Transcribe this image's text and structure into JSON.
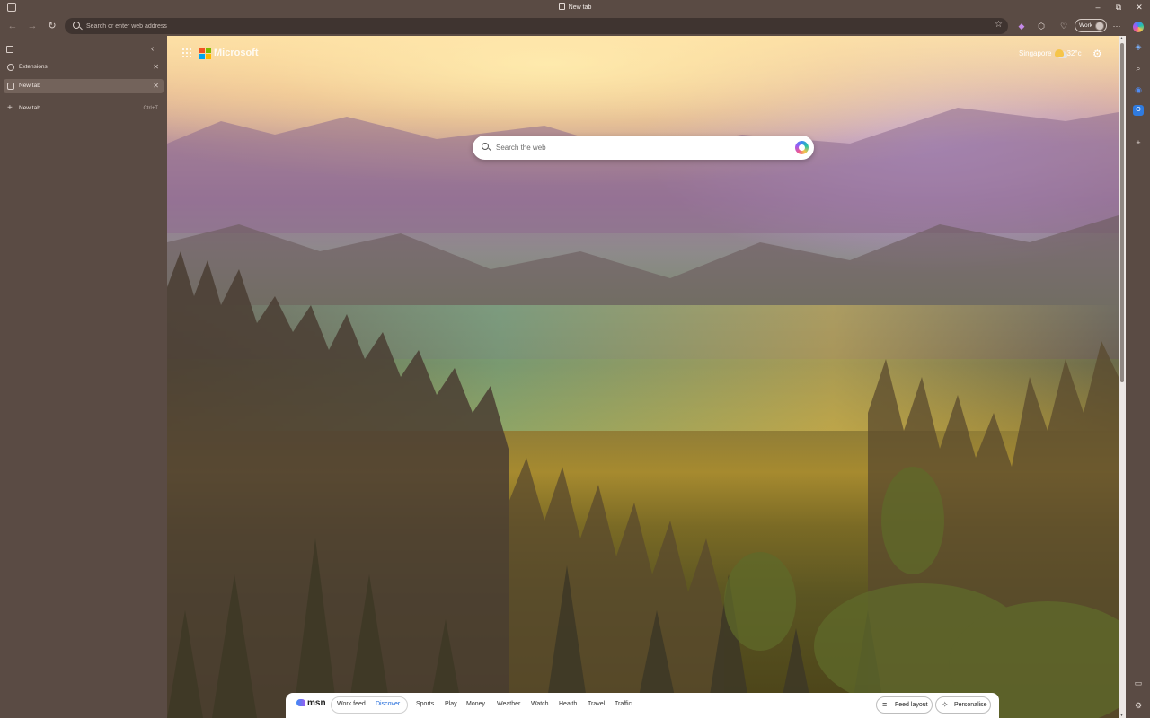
{
  "window": {
    "title": "New tab",
    "controls": {
      "minimize": "–",
      "restore": "⧉",
      "close": "✕"
    }
  },
  "toolbar": {
    "back_icon": "←",
    "forward_icon": "→",
    "refresh_icon": "↻",
    "address_placeholder": "Search or enter web address",
    "favorite_icon": "☆",
    "profile_label": "Work",
    "more_icon": "⋯"
  },
  "tabs_panel": {
    "collapse_icon": "‹",
    "tabs": [
      {
        "label": "Extensions",
        "close": "✕"
      },
      {
        "label": "New tab",
        "close": "✕",
        "active": true
      }
    ],
    "new_tab": {
      "plus": "+",
      "label": "New tab",
      "shortcut": "Ctrl+T"
    }
  },
  "ntp": {
    "brand": "Microsoft",
    "brand_colors": [
      "#f25022",
      "#7fba00",
      "#00a4ef",
      "#ffb900"
    ],
    "weather": {
      "city": "Singapore",
      "temp": "32°c"
    },
    "settings_icon": "⚙",
    "search_placeholder": "Search the web"
  },
  "msn": {
    "logo": "msn",
    "feed_tabs": [
      "Work feed",
      "Discover"
    ],
    "active_feed": "Discover",
    "links": [
      "Sports",
      "Play",
      "Money",
      "Weather",
      "Watch",
      "Health",
      "Travel",
      "Traffic"
    ],
    "feed_layout_label": "Feed layout",
    "personalise_label": "Personalise"
  },
  "edge_sidebar": {
    "icons": [
      "copilot-icon",
      "collections-icon",
      "search-icon",
      "office-icon",
      "outlook-icon",
      "add-icon",
      "screen-icon",
      "settings-icon"
    ]
  }
}
